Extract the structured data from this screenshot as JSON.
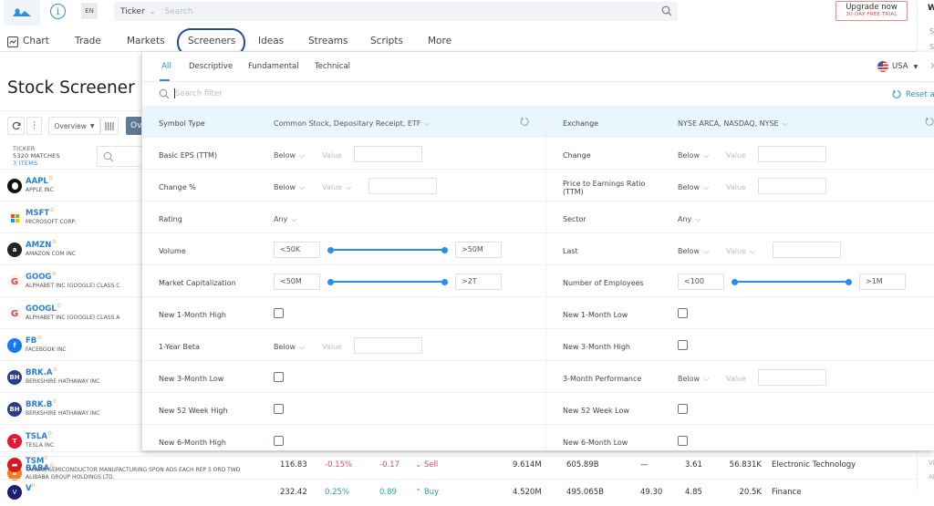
{
  "header": {
    "lang": "EN",
    "search_type": "Ticker",
    "search_placeholder": "Search",
    "upgrade_label": "Upgrade now",
    "upgrade_sub": "30-DAY FREE TRIAL"
  },
  "nav": {
    "items": [
      "Chart",
      "Trade",
      "Markets",
      "Screeners",
      "Ideas",
      "Streams",
      "Scripts",
      "More"
    ],
    "highlighted": "Screeners"
  },
  "right_panel": {
    "title_partial": "W",
    "row1": "Sy",
    "row2": "St",
    "bottom1": "Vi",
    "bottom2": "Al"
  },
  "screener": {
    "title": "Stock Screener",
    "view_select": "Overview",
    "tab_partial": "Ov",
    "ticker_header": "TICKER",
    "matches": "5320 MATCHES",
    "items": "3 ITEMS",
    "rows": [
      {
        "symbol": "AAPL",
        "name": "APPLE INC",
        "icon": "apple-logo",
        "color": "#111111",
        "glyph": "●"
      },
      {
        "symbol": "MSFT",
        "name": "MICROSOFT CORP.",
        "icon": "microsoft-logo",
        "color": "#ffffff",
        "glyph": ""
      },
      {
        "symbol": "AMZN",
        "name": "AMAZON COM INC",
        "icon": "amazon-logo",
        "color": "#222222",
        "glyph": "a"
      },
      {
        "symbol": "GOOG",
        "name": "ALPHABET INC (GOOGLE) CLASS C",
        "icon": "google-logo",
        "color": "#ffffff",
        "glyph": "G"
      },
      {
        "symbol": "GOOGL",
        "name": "ALPHABET INC (GOOGLE) CLASS A",
        "icon": "google-logo",
        "color": "#ffffff",
        "glyph": "G"
      },
      {
        "symbol": "FB",
        "name": "FACEBOOK INC",
        "icon": "facebook-logo",
        "color": "#1877f2",
        "glyph": "f"
      },
      {
        "symbol": "BRK.A",
        "name": "BERKSHIRE HATHAWAY INC",
        "icon": "berkshire-logo",
        "color": "#2e3a8c",
        "glyph": "BH"
      },
      {
        "symbol": "BRK.B",
        "name": "BERKSHIRE HATHAWAY INC",
        "icon": "berkshire-logo",
        "color": "#2e3a8c",
        "glyph": "BH"
      },
      {
        "symbol": "TSLA",
        "name": "TESLA INC",
        "icon": "tesla-logo",
        "color": "#e31937",
        "glyph": "T"
      },
      {
        "symbol": "BABA",
        "name": "ALIBABA GROUP HOLDINGS LTD.",
        "icon": "alibaba-logo",
        "color": "#ff7a1a",
        "glyph": "a"
      },
      {
        "symbol": "TSM",
        "name": "TAIWAN SEMICONDUCTOR MANUFACTURING SPON ADS EACH REP 5 ORD TWD",
        "icon": "tsmc-logo",
        "color": "#d71920",
        "glyph": "▬"
      },
      {
        "symbol": "V",
        "name": "",
        "icon": "visa-logo",
        "color": "#1a1f71",
        "glyph": "V"
      }
    ],
    "delay_badge": "D",
    "bottom_data": [
      {
        "last": "116.83",
        "chg_pct": "-0.15%",
        "chg": "-0.17",
        "rating": "Sell",
        "vol": "9.614M",
        "mktcap": "605.89B",
        "pe": "—",
        "eps": "3.61",
        "employees": "56.831K",
        "sector": "Electronic Technology",
        "dir": "down"
      },
      {
        "last": "232.42",
        "chg_pct": "0.25%",
        "chg": "0.89",
        "rating": "Buy",
        "vol": "4.520M",
        "mktcap": "495.065B",
        "pe": "49.30",
        "eps": "4.85",
        "employees": "20.5K",
        "sector": "Finance",
        "dir": "up"
      }
    ]
  },
  "filter_panel": {
    "tabs": [
      "All",
      "Descriptive",
      "Fundamental",
      "Technical"
    ],
    "active_tab": "All",
    "country": "USA",
    "search_placeholder": "Search filter",
    "reset_all": "Reset all",
    "left": [
      {
        "label": "Symbol Type",
        "type": "select",
        "value": "Common Stock, Depositary Receipt, ETF",
        "highlight": true
      },
      {
        "label": "Basic EPS (TTM)",
        "type": "compare",
        "op": "Below",
        "value_ph": "Value"
      },
      {
        "label": "Change %",
        "type": "compare-dd",
        "op": "Below",
        "value_ph": "Value"
      },
      {
        "label": "Rating",
        "type": "select",
        "value": "Any"
      },
      {
        "label": "Volume",
        "type": "range",
        "min": "<50K",
        "max": ">50M",
        "low": 0,
        "high": 1
      },
      {
        "label": "Market Capitalization",
        "type": "range",
        "min": "<50M",
        "max": ">2T",
        "low": 0,
        "high": 1
      },
      {
        "label": "New 1-Month High",
        "type": "checkbox",
        "checked": false
      },
      {
        "label": "1-Year Beta",
        "type": "compare",
        "op": "Below",
        "value_ph": "Value"
      },
      {
        "label": "New 3-Month Low",
        "type": "checkbox",
        "checked": false
      },
      {
        "label": "New 52 Week High",
        "type": "checkbox",
        "checked": false
      },
      {
        "label": "New 6-Month High",
        "type": "checkbox",
        "checked": false
      }
    ],
    "right": [
      {
        "label": "Exchange",
        "type": "select",
        "value": "NYSE ARCA, NASDAQ, NYSE",
        "highlight": true
      },
      {
        "label": "Change",
        "type": "compare",
        "op": "Below",
        "value_ph": "Value"
      },
      {
        "label": "Price to Earnings Ratio (TTM)",
        "type": "compare",
        "op": "Below",
        "value_ph": "Value"
      },
      {
        "label": "Sector",
        "type": "select",
        "value": "Any"
      },
      {
        "label": "Last",
        "type": "compare-dd",
        "op": "Below",
        "value_ph": "Value"
      },
      {
        "label": "Number of Employees",
        "type": "range",
        "min": "<100",
        "max": ">1M",
        "low": 0,
        "high": 1
      },
      {
        "label": "New 1-Month Low",
        "type": "checkbox",
        "checked": false
      },
      {
        "label": "New 3-Month High",
        "type": "checkbox",
        "checked": false
      },
      {
        "label": "3-Month Performance",
        "type": "compare",
        "op": "Below",
        "value_ph": "Value"
      },
      {
        "label": "New 52 Week Low",
        "type": "checkbox",
        "checked": false
      },
      {
        "label": "New 6-Month Low",
        "type": "checkbox",
        "checked": false
      }
    ]
  }
}
